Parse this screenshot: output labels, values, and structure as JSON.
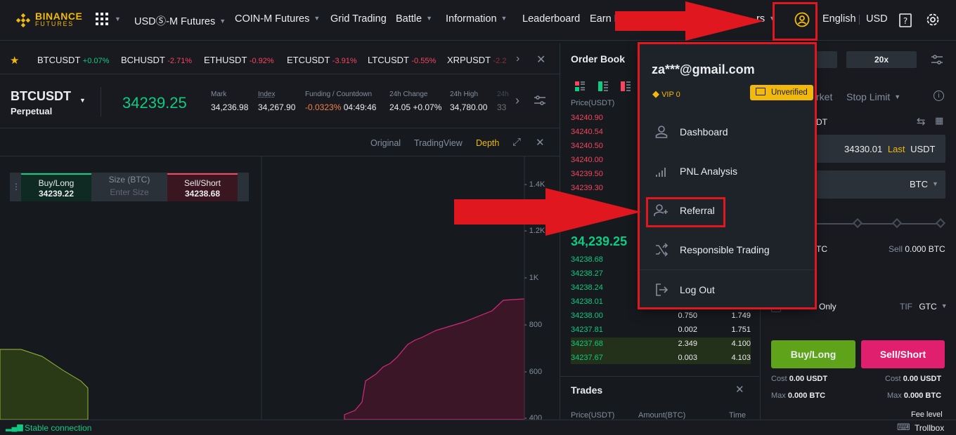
{
  "logo": {
    "word1": "BINANCE",
    "word2": "FUTURES"
  },
  "nav": [
    {
      "label": "USDⓈ-M Futures",
      "dropdown": true
    },
    {
      "label": "COIN-M Futures",
      "dropdown": true
    },
    {
      "label": "Grid Trading",
      "dropdown": false
    },
    {
      "label": "Battle",
      "dropdown": true
    },
    {
      "label": "Information",
      "dropdown": true
    },
    {
      "label": "Leaderboard",
      "dropdown": false
    },
    {
      "label": "Earn E",
      "dropdown": false
    }
  ],
  "nav_right": {
    "partial": "rs",
    "language": "English",
    "currency": "USD"
  },
  "tickers": [
    {
      "symbol": "BTCUSDT",
      "change": "+0.07%"
    },
    {
      "symbol": "BCHUSDT",
      "change": "-2.71%"
    },
    {
      "symbol": "ETHUSDT",
      "change": "-0.92%"
    },
    {
      "symbol": "ETCUSDT",
      "change": "-3.91%"
    },
    {
      "symbol": "LTCUSDT",
      "change": "-0.55%"
    },
    {
      "symbol": "XRPUSDT",
      "change": "-2.2"
    }
  ],
  "symbol": {
    "name": "BTCUSDT",
    "type": "Perpetual",
    "last_price": "34239.25",
    "stats": [
      {
        "label": "Mark",
        "value": "34,236.98"
      },
      {
        "label": "Index",
        "value": "34,267.90"
      },
      {
        "label": "Funding / Countdown",
        "value": "-0.0323%",
        "value2": "04:49:46"
      },
      {
        "label": "24h Change",
        "value": "24.05 +0.07%"
      },
      {
        "label": "24h High",
        "value": "34,780.00"
      },
      {
        "label": "24h",
        "value": "33"
      }
    ]
  },
  "chart_tabs": {
    "original": "Original",
    "tradingview": "TradingView",
    "depth": "Depth"
  },
  "quick_trade": {
    "buy_label": "Buy/Long",
    "buy_price": "34239.22",
    "size_label": "Size (BTC)",
    "size_placeholder": "Enter Size",
    "sell_label": "Sell/Short",
    "sell_price": "34238.68"
  },
  "depth_axis": [
    "1.4K",
    "1.2K",
    "1K",
    "800",
    "600",
    "400"
  ],
  "order_book": {
    "title": "Order Book",
    "price_header": "Price(USDT)",
    "asks": [
      "34240.90",
      "34240.54",
      "34240.50",
      "34240.00",
      "34239.50",
      "34239.30"
    ],
    "mid_price": "34,239.25",
    "bids": [
      {
        "price": "34238.68",
        "amount": "",
        "total": ""
      },
      {
        "price": "34238.27",
        "amount": "",
        "total": ""
      },
      {
        "price": "34238.24",
        "amount": "",
        "total": ""
      },
      {
        "price": "34238.01",
        "amount": "",
        "total": ""
      },
      {
        "price": "34238.00",
        "amount": "0.750",
        "total": "1.749"
      },
      {
        "price": "34237.81",
        "amount": "0.002",
        "total": "1.751"
      },
      {
        "price": "34237.68",
        "amount": "2.349",
        "total": "4.100"
      },
      {
        "price": "34237.67",
        "amount": "0.003",
        "total": "4.103"
      }
    ]
  },
  "trades": {
    "title": "Trades",
    "col_price": "Price(USDT)",
    "col_amount": "Amount(BTC)",
    "col_time": "Time"
  },
  "form": {
    "leverage": "20x",
    "order_types": [
      "rket",
      "Stop Limit"
    ],
    "unit": "DT",
    "price_value": "34330.01",
    "price_last": "Last",
    "price_unit": "USDT",
    "size_unit": "BTC",
    "buy_avail": "TC",
    "sell_label": "Sell",
    "sell_avail": "0.000 BTC",
    "reduce_only": "Only",
    "tif_label": "TIF",
    "tif_value": "GTC",
    "buy_button": "Buy/Long",
    "sell_button": "Sell/Short",
    "cost_label": "Cost",
    "buy_cost": "0.00 USDT",
    "sell_cost": "0.00 USDT",
    "max_label": "Max",
    "buy_max": "0.000 BTC",
    "sell_max": "0.000 BTC",
    "fee_level": "Fee level"
  },
  "account_menu": {
    "email": "za***@gmail.com",
    "vip": "VIP 0",
    "verification": "Unverified",
    "items": [
      {
        "label": "Dashboard",
        "icon": "user-icon"
      },
      {
        "label": "PNL Analysis",
        "icon": "bar-chart-icon"
      },
      {
        "label": "Referral",
        "icon": "add-user-icon"
      },
      {
        "label": "Responsible Trading",
        "icon": "shuffle-icon"
      },
      {
        "label": "Log Out",
        "icon": "logout-icon"
      }
    ]
  },
  "status": {
    "connection": "Stable connection",
    "trollbox": "Trollbox"
  },
  "colors": {
    "accent": "#f0b90b",
    "buy": "#0ecb81",
    "sell": "#f6465d",
    "annotation": "#e0171f"
  }
}
